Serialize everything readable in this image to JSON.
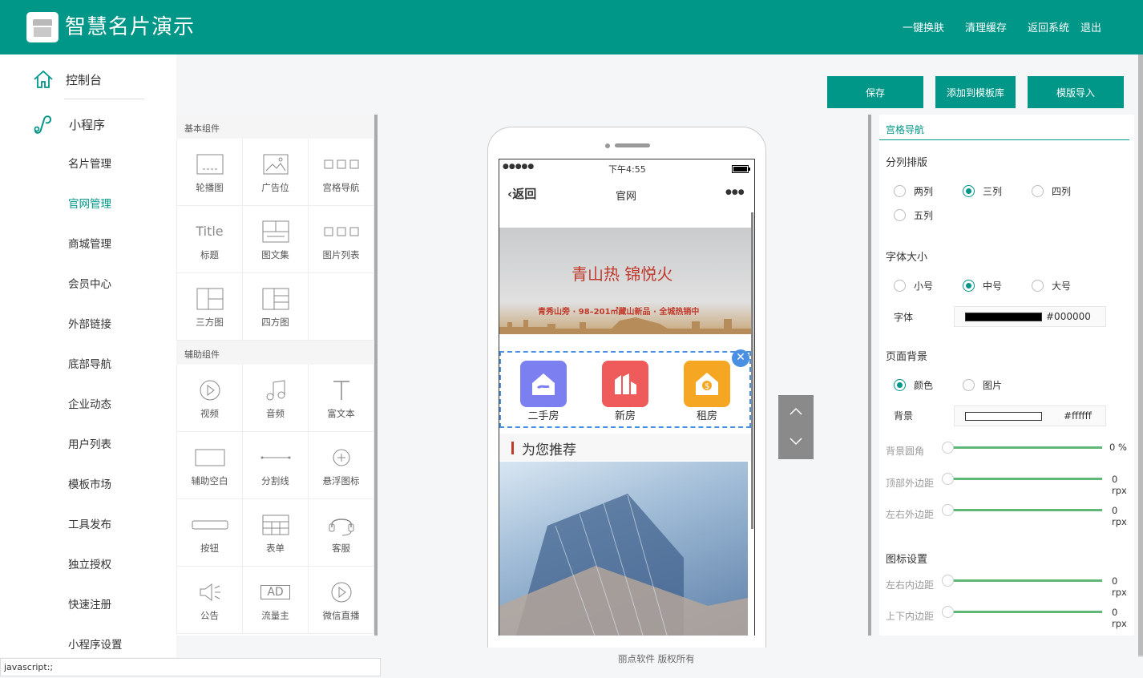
{
  "app": {
    "title": "智慧名片演示"
  },
  "topnav": [
    "一键换肤",
    "清理缓存",
    "返回系统",
    "退出"
  ],
  "sidebar": {
    "dashboard": "控制台",
    "miniprogram": "小程序",
    "items": [
      "名片管理",
      "官网管理",
      "商城管理",
      "会员中心",
      "外部链接",
      "底部导航",
      "企业动态",
      "用户列表",
      "模板市场",
      "工具发布",
      "独立授权",
      "快速注册",
      "小程序设置"
    ],
    "active": "官网管理"
  },
  "status": "javascript:;",
  "components": {
    "basic_title": "基本组件",
    "basic": [
      "轮播图",
      "广告位",
      "宫格导航",
      "标题",
      "图文集",
      "图片列表",
      "三方图",
      "四方图"
    ],
    "title_icon_text": "Title",
    "aux_title": "辅助组件",
    "aux": [
      "视频",
      "音频",
      "富文本",
      "辅助空白",
      "分割线",
      "悬浮图标",
      "按钮",
      "表单",
      "客服",
      "公告",
      "流量主",
      "微信直播"
    ],
    "ad_icon_text": "AD"
  },
  "actions": {
    "save": "保存",
    "add_template": "添加到模板库",
    "import_template": "模版导入"
  },
  "phone": {
    "signal": "●●●●●",
    "time": "下午4:55",
    "back": "返回",
    "page_title": "官网",
    "more": "●●●",
    "banner_headline": "青山热 锦悦火",
    "banner_sub": "青秀山旁 · 98–201㎡藏山新品 · 全城热销中",
    "nav_items": [
      "二手房",
      "新房",
      "租房"
    ],
    "recommend": "为您推荐"
  },
  "panel": {
    "tab": "宫格导航",
    "columns_title": "分列排版",
    "columns": [
      "两列",
      "三列",
      "四列",
      "五列"
    ],
    "columns_selected": "三列",
    "fontsize_title": "字体大小",
    "fontsizes": [
      "小号",
      "中号",
      "大号"
    ],
    "fontsize_selected": "中号",
    "font_label": "字体",
    "font_color": "#000000",
    "bg_title": "页面背景",
    "bg_options": [
      "颜色",
      "图片"
    ],
    "bg_selected": "颜色",
    "bg_label": "背景",
    "bg_color": "#ffffff",
    "sliders": [
      {
        "label": "背景圆角",
        "value": 0,
        "unit": "%"
      },
      {
        "label": "顶部外边距",
        "value": 0,
        "unit": "rpx"
      },
      {
        "label": "左右外边距",
        "value": 0,
        "unit": "rpx"
      }
    ],
    "icon_title": "图标设置",
    "icon_sliders": [
      {
        "label": "左右内边距",
        "value": 0,
        "unit": "rpx"
      },
      {
        "label": "上下内边距",
        "value": 0,
        "unit": "rpx"
      }
    ]
  },
  "footer": "丽点软件 版权所有",
  "colors": {
    "primary": "#009688",
    "slider": "#5fb878",
    "nav1": "#7b7ff0",
    "nav2": "#ef5b5b",
    "nav3": "#f5a623"
  }
}
